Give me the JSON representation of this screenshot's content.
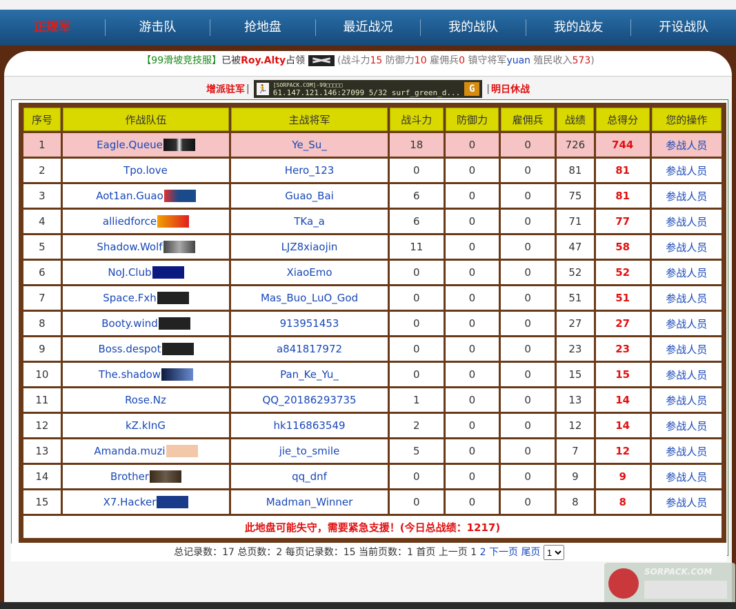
{
  "nav": {
    "items": [
      "正规军",
      "游击队",
      "抢地盘",
      "最近战况",
      "我的战队",
      "我的战友",
      "开设战队"
    ],
    "active_index": 0
  },
  "info": {
    "server_bracket": "【99滑坡竞技服】",
    "captured_by_prefix": "已被",
    "captured_by": "Roy.Alty",
    "occupied": "占领",
    "stats_open": "(战斗力",
    "power": "15",
    "defense_label": "防御力",
    "defense": "10",
    "merc_label": "雇佣兵",
    "merc": "0",
    "guard_label": "镇守将军",
    "guard": "yuan",
    "income_label": "殖民收入",
    "income": "573",
    "stats_close": ")"
  },
  "action_bar": {
    "reinforce": "增派驻军",
    "server_title": "[SORPACK.COM]-99□□□□□",
    "server_addr": "61.147.121.146:27099",
    "players": "5/32",
    "map": "surf_green_d...",
    "truce": "明日休战"
  },
  "table": {
    "headers": [
      "序号",
      "作战队伍",
      "主战将军",
      "战斗力",
      "防御力",
      "雇佣兵",
      "战绩",
      "总得分",
      "您的操作"
    ],
    "rows": [
      {
        "no": "1",
        "team": "Eagle.Queue",
        "leader": "Ye_Su_",
        "power": "18",
        "defense": "0",
        "merc": "0",
        "record": "726",
        "score": "744",
        "op": "参战人员"
      },
      {
        "no": "2",
        "team": "Tpo.love",
        "leader": "Hero_123",
        "power": "0",
        "defense": "0",
        "merc": "0",
        "record": "81",
        "score": "81",
        "op": "参战人员"
      },
      {
        "no": "3",
        "team": "Aot1an.Guao",
        "leader": "Guao_Bai",
        "power": "6",
        "defense": "0",
        "merc": "0",
        "record": "75",
        "score": "81",
        "op": "参战人员"
      },
      {
        "no": "4",
        "team": "alliedforce",
        "leader": "TKa_a",
        "power": "6",
        "defense": "0",
        "merc": "0",
        "record": "71",
        "score": "77",
        "op": "参战人员"
      },
      {
        "no": "5",
        "team": "Shadow.Wolf",
        "leader": "LJZ8xiaojin",
        "power": "11",
        "defense": "0",
        "merc": "0",
        "record": "47",
        "score": "58",
        "op": "参战人员"
      },
      {
        "no": "6",
        "team": "NoJ.Club",
        "leader": "XiaoEmo",
        "power": "0",
        "defense": "0",
        "merc": "0",
        "record": "52",
        "score": "52",
        "op": "参战人员"
      },
      {
        "no": "7",
        "team": "Space.Fxh",
        "leader": "Mas_Buo_LuO_God",
        "power": "0",
        "defense": "0",
        "merc": "0",
        "record": "51",
        "score": "51",
        "op": "参战人员"
      },
      {
        "no": "8",
        "team": "Booty.wind",
        "leader": "913951453",
        "power": "0",
        "defense": "0",
        "merc": "0",
        "record": "27",
        "score": "27",
        "op": "参战人员"
      },
      {
        "no": "9",
        "team": "Boss.despot",
        "leader": "a841817972",
        "power": "0",
        "defense": "0",
        "merc": "0",
        "record": "23",
        "score": "23",
        "op": "参战人员"
      },
      {
        "no": "10",
        "team": "The.shadow",
        "leader": "Pan_Ke_Yu_",
        "power": "0",
        "defense": "0",
        "merc": "0",
        "record": "15",
        "score": "15",
        "op": "参战人员"
      },
      {
        "no": "11",
        "team": "Rose.Nz",
        "leader": "QQ_20186293735",
        "power": "1",
        "defense": "0",
        "merc": "0",
        "record": "13",
        "score": "14",
        "op": "参战人员"
      },
      {
        "no": "12",
        "team": "kZ.kInG",
        "leader": "hk116863549",
        "power": "2",
        "defense": "0",
        "merc": "0",
        "record": "12",
        "score": "14",
        "op": "参战人员"
      },
      {
        "no": "13",
        "team": "Amanda.muzi",
        "leader": "jie_to_smile",
        "power": "5",
        "defense": "0",
        "merc": "0",
        "record": "7",
        "score": "12",
        "op": "参战人员"
      },
      {
        "no": "14",
        "team": "Brother",
        "leader": "qq_dnf",
        "power": "0",
        "defense": "0",
        "merc": "0",
        "record": "9",
        "score": "9",
        "op": "参战人员"
      },
      {
        "no": "15",
        "team": "X7.Hacker",
        "leader": "Madman_Winner",
        "power": "0",
        "defense": "0",
        "merc": "0",
        "record": "8",
        "score": "8",
        "op": "参战人员"
      }
    ],
    "notice": "此地盘可能失守，需要紧急支援！(今日总战绩：1217)"
  },
  "pager": {
    "summary": "总记录数：17 总页数：2 每页记录数：15 当前页数：1 首页 上一页 1",
    "page2": "2",
    "next": "下一页",
    "last": "尾页",
    "select_value": "1"
  },
  "watermark": {
    "site": "SORPACK.COM"
  },
  "colors": {
    "nav_bg": "#1e5a8f",
    "frame": "#5b2a10",
    "header_bg": "#d9d900",
    "highlight_row": "#f6c4c4",
    "score_red": "#e01010",
    "link_blue": "#1848b8"
  }
}
